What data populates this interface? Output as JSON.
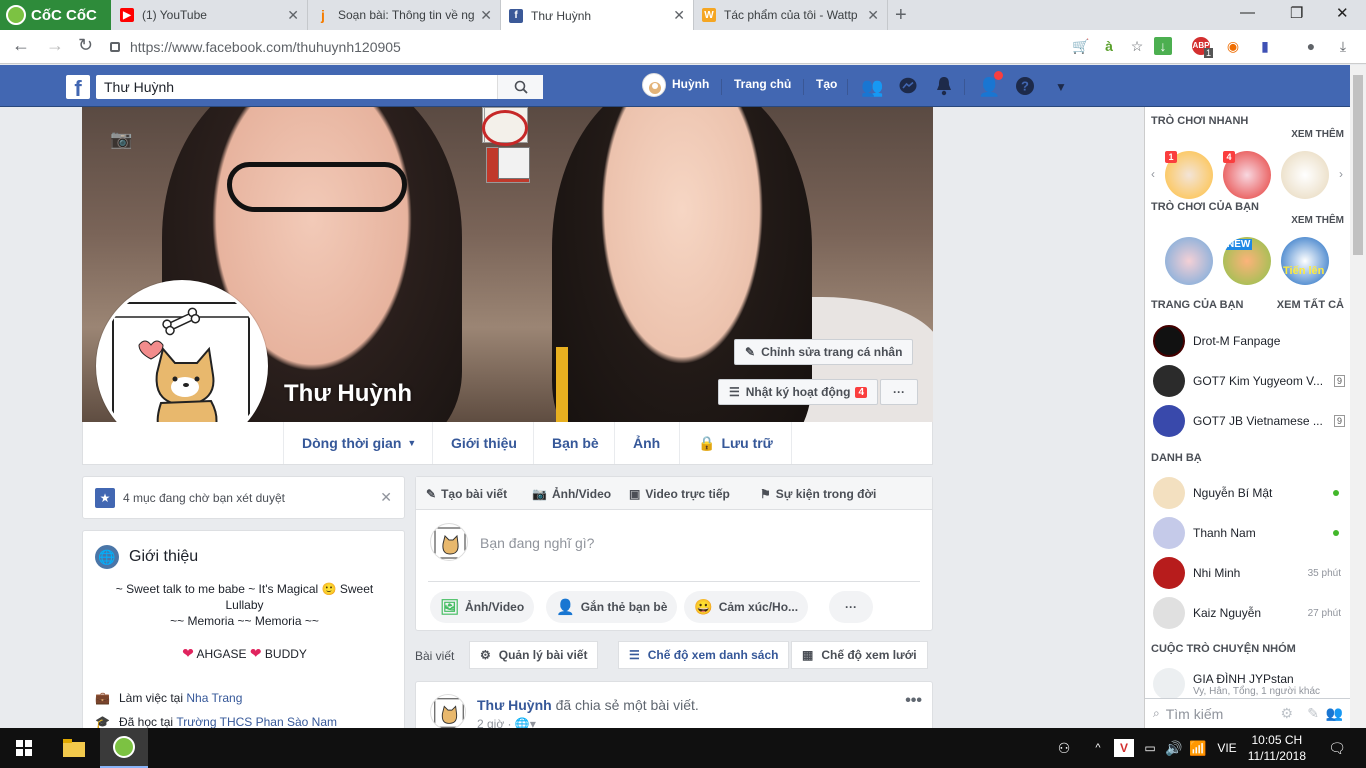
{
  "browser": {
    "brand": "CốC CốC",
    "tabs": [
      {
        "title": "(1) YouTube",
        "favicon": "youtube-icon"
      },
      {
        "title": "Soạn bài: Thông tin về ng",
        "favicon": "j-icon"
      },
      {
        "title": "Thư Huỳnh",
        "favicon": "facebook-icon"
      },
      {
        "title": "Tác phẩm của tôi - Wattp",
        "favicon": "wattpad-icon"
      }
    ],
    "url": "https://www.facebook.com/thuhuynh120905",
    "ext_badge": "1"
  },
  "fb": {
    "search_value": "Thư Huỳnh",
    "user": "Huỳnh",
    "home": "Trang chủ",
    "create": "Tạo"
  },
  "profile": {
    "name": "Thư Huỳnh",
    "edit_button": "Chỉnh sửa trang cá nhân",
    "activity_log": "Nhật ký hoạt động",
    "activity_count": "4",
    "more": "···",
    "tabs": [
      "Dòng thời gian",
      "Giới thiệu",
      "Bạn bè",
      "Ảnh",
      "Lưu trữ"
    ]
  },
  "pending": {
    "text": "4 mục đang chờ bạn xét duyệt"
  },
  "intro": {
    "title": "Giới thiệu",
    "bio1": "~ Sweet talk to me babe ~ It's Magical",
    "bio1b": "Sweet",
    "bio2": "Lullaby",
    "bio3": "~~ Memoria ~~ Memoria ~~",
    "tag1": "AHGASE",
    "tag2": "BUDDY",
    "work_prefix": "Làm việc tại",
    "work_place": "Nha Trang",
    "school_prefix": "Đã học tại",
    "school_place": "Trường THCS Phan Sào Nam"
  },
  "composer": {
    "tabs": [
      "Tạo bài viết",
      "Ảnh/Video",
      "Video trực tiếp",
      "Sự kiện trong đời"
    ],
    "placeholder": "Bạn đang nghĩ gì?",
    "actions": [
      "Ảnh/Video",
      "Gắn thẻ bạn bè",
      "Cảm xúc/Ho..."
    ],
    "more": "···"
  },
  "posts_bar": {
    "label": "Bài viết",
    "manage": "Quản lý bài viết",
    "list_view": "Chế độ xem danh sách",
    "grid_view": "Chế độ xem lưới"
  },
  "post": {
    "author": "Thư Huỳnh",
    "action": "đã chia sẻ một bài viết.",
    "time": "2 giờ ·"
  },
  "sidebar": {
    "quick_games": "TRÒ CHƠI NHANH",
    "see_more": "XEM THÊM",
    "your_games": "TRÒ CHƠI CỦA BẠN",
    "game_badges": [
      "1",
      "4"
    ],
    "game_labels": [
      "NEW",
      "Tiến lên"
    ],
    "your_pages": "TRANG CỦA BẠN",
    "see_all": "XEM TẤT CẢ",
    "pages": [
      {
        "name": "Drot-M Fanpage",
        "count": ""
      },
      {
        "name": "GOT7 Kim Yugyeom V...",
        "count": "9"
      },
      {
        "name": "GOT7 JB Vietnamese ...",
        "count": "9"
      }
    ],
    "contacts_title": "DANH BẠ",
    "contacts": [
      {
        "name": "Nguyễn Bí Mật",
        "status": ""
      },
      {
        "name": "Thanh Nam",
        "status": ""
      },
      {
        "name": "Nhi Minh",
        "status": "35 phút"
      },
      {
        "name": "Kaiz Nguyễn",
        "status": "27 phút"
      }
    ],
    "group_title": "CUỘC TRÒ CHUYỆN NHÓM",
    "group": {
      "name": "GIA ĐÌNH JYPstan",
      "sub": "Vy, Hân, Tổng, 1 người khác"
    },
    "search_placeholder": "Tìm kiếm"
  },
  "taskbar": {
    "lang": "VIE",
    "time": "10:05 CH",
    "date": "11/11/2018"
  },
  "colors": {
    "fb_blue": "#4267b2",
    "link": "#365899",
    "online": "#42b72a",
    "alert": "#fa3e3e"
  }
}
